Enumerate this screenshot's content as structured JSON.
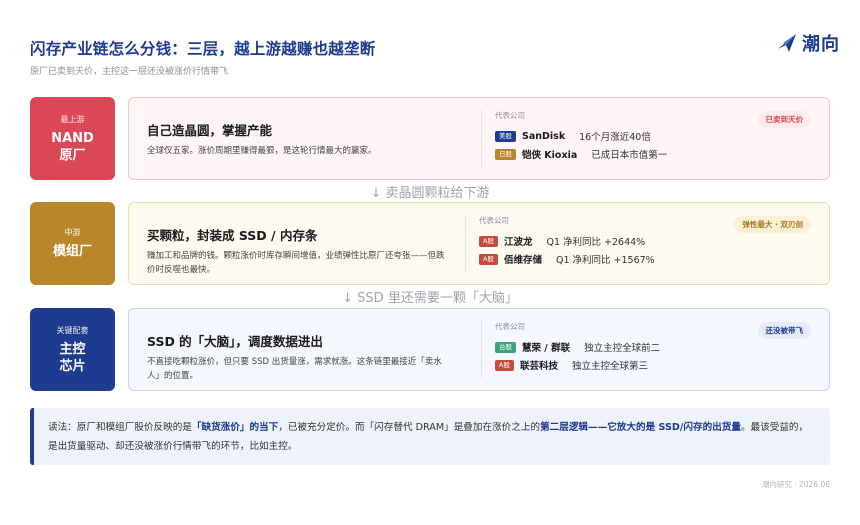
{
  "header": {
    "title": "闪存产业链怎么分钱：三层，越上游越赚也越垄断",
    "subtitle": "原厂已卖到天价，主控这一层还没被涨价行情带飞",
    "brand": "潮向",
    "brand_icon": "bird-icon"
  },
  "tiers": [
    {
      "badge_small": "最上游",
      "badge_line1": "NAND",
      "badge_line2": "原厂",
      "badge_color": "#d94854",
      "heading": "自己造晶圆，掌握产能",
      "desc": "全球仅五家。涨价周期里赚得最狠，是这轮行情最大的赢家。",
      "companies_title": "代表公司",
      "companies": [
        {
          "tag": "美股",
          "tag_color": "#1d3b8f",
          "name": "SanDisk",
          "note": "16个月涨近40倍"
        },
        {
          "tag": "日股",
          "tag_color": "#b8862b",
          "name": "铠侠 Kioxia",
          "note": "已成日本市值第一"
        }
      ],
      "pill": "已卖到天价",
      "pill_color": "#d94854",
      "pill_bg": "#fdeaec",
      "card_bg": "#fff5f6",
      "card_border": "#f3c4c9"
    },
    {
      "badge_small": "中游",
      "badge_line1": "模组厂",
      "badge_line2": "",
      "badge_color": "#b8862b",
      "heading": "买颗粒，封装成 SSD / 内存条",
      "desc": "赚加工和品牌的钱。颗粒涨价时库存瞬间增值，业绩弹性比原厂还夸张——但跌价时反噬也最快。",
      "companies_title": "代表公司",
      "companies": [
        {
          "tag": "A股",
          "tag_color": "#c64b3f",
          "name": "江波龙",
          "note": "Q1 净利同比 +2644%"
        },
        {
          "tag": "A股",
          "tag_color": "#c64b3f",
          "name": "佰维存储",
          "note": "Q1 净利同比 +1567%"
        }
      ],
      "pill": "弹性最大 · 双刃剑",
      "pill_color": "#a6791f",
      "pill_bg": "#fbefd6",
      "card_bg": "#fffaf0",
      "card_border": "#ecdcb7"
    },
    {
      "badge_small": "关键配套",
      "badge_line1": "主控",
      "badge_line2": "芯片",
      "badge_color": "#1d3b8f",
      "heading": "SSD 的「大脑」，调度数据进出",
      "desc": "不直接吃颗粒涨价，但只要 SSD 出货量涨，需求就涨。这条链里最接近「卖水人」的位置。",
      "companies_title": "代表公司",
      "companies": [
        {
          "tag": "台股",
          "tag_color": "#3aa57a",
          "name": "慧荣 / 群联",
          "note": "独立主控全球前二"
        },
        {
          "tag": "A股",
          "tag_color": "#c64b3f",
          "name": "联芸科技",
          "note": "独立主控全球第三"
        }
      ],
      "pill": "还没被带飞",
      "pill_color": "#1d3b8f",
      "pill_bg": "#e5ebf8",
      "card_bg": "#f4f7fd",
      "card_border": "#c9d5ee"
    }
  ],
  "flows": [
    "↓ 卖晶圆颗粒给下游",
    "↓ SSD 里还需要一颗「大脑」"
  ],
  "note": {
    "p1": "读法：原厂和模组厂股价反映的是",
    "h1": "「缺货涨价」的当下",
    "p2": "，已被充分定价。而「闪存替代 DRAM」是叠加在涨价之上的",
    "h2": "第二层逻辑——它放大的是 SSD/闪存的出货量",
    "p3": "。最该受益的，是出货量驱动、却还没被涨价行情带飞的环节，比如主控。"
  },
  "footer": "潮向研究 · 2026.06"
}
